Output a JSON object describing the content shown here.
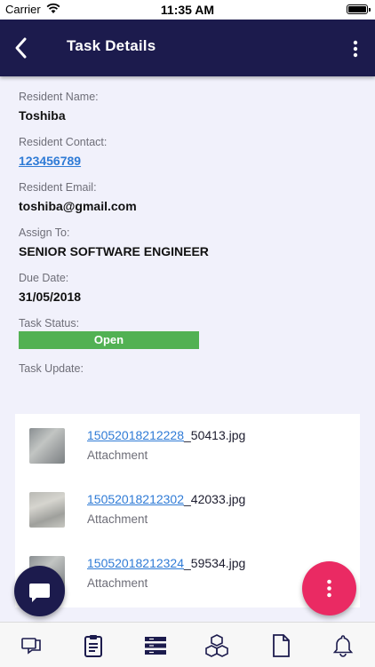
{
  "status_bar": {
    "carrier": "Carrier",
    "time": "11:35 AM"
  },
  "header": {
    "title": "Task Details"
  },
  "details": {
    "resident_name_label": "Resident Name:",
    "resident_name": "Toshiba",
    "resident_contact_label": "Resident Contact:",
    "resident_contact": "123456789",
    "resident_email_label": "Resident Email:",
    "resident_email": "toshiba@gmail.com",
    "assign_to_label": "Assign To:",
    "assign_to": "SENIOR SOFTWARE ENGINEER",
    "due_date_label": "Due Date:",
    "due_date": "31/05/2018",
    "task_status_label": "Task Status:",
    "task_status": "Open",
    "task_update_label": "Task Update:"
  },
  "attachments": [
    {
      "code": "15052018212228",
      "suffix": "_50413.jpg",
      "type": "Attachment"
    },
    {
      "code": "15052018212302",
      "suffix": "_42033.jpg",
      "type": "Attachment"
    },
    {
      "code": "15052018212324",
      "suffix": "_59534.jpg",
      "type": "Attachment"
    }
  ],
  "colors": {
    "header_bg": "#1c1b4d",
    "status_open": "#52b153",
    "link": "#2f7bd6",
    "fab_menu": "#ea2a63"
  },
  "tab_icons": [
    "chat-bubbles-icon",
    "clipboard-icon",
    "list-stack-icon",
    "boxes-icon",
    "document-icon",
    "bell-icon"
  ]
}
